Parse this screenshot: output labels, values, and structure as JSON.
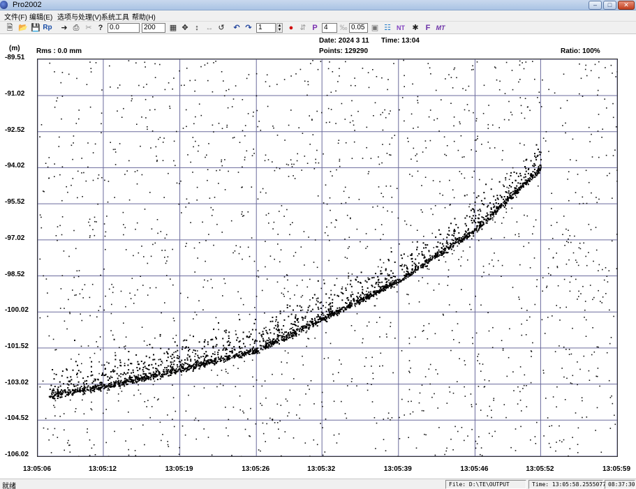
{
  "window": {
    "title": "Pro2002"
  },
  "menu": [
    "文件(F)",
    "编辑(E)",
    "选项与处理(V)",
    "系统工具",
    "帮助(H)"
  ],
  "toolbar": {
    "field_a": "0.0",
    "field_b": "200",
    "field_c": "1",
    "field_d": "4",
    "field_e": "0.05",
    "labels": {
      "rp": "Rp",
      "po": "P",
      "ft": "F",
      "mt": "MT",
      "nt": "NT"
    }
  },
  "header": {
    "unit": "(m)",
    "rms": "Rms :   0.0 mm",
    "date": "Date: 2024  3 11",
    "time": "Time: 13:04",
    "points": "Points: 129290",
    "ratio": "Ratio: 100%"
  },
  "chart_data": {
    "type": "scatter",
    "title": "",
    "xlabel": "",
    "ylabel": "(m)",
    "xlim": [
      "13:05:06",
      "13:05:59"
    ],
    "ylim": [
      -106.02,
      -89.51
    ],
    "x_ticks": [
      "13:05:06",
      "13:05:12",
      "13:05:19",
      "13:05:26",
      "13:05:32",
      "13:05:39",
      "13:05:46",
      "13:05:52",
      "13:05:59"
    ],
    "y_ticks": [
      "-89.51",
      "-91.02",
      "-92.52",
      "-94.02",
      "-95.52",
      "-97.02",
      "-98.52",
      "-100.02",
      "-101.52",
      "-103.02",
      "-104.52",
      "-106.02"
    ],
    "grid": true,
    "series": [
      {
        "x": [
          "13:05:07",
          "13:05:12",
          "13:05:19",
          "13:05:26",
          "13:05:32",
          "13:05:39",
          "13:05:46",
          "13:05:52"
        ],
        "y": [
          -103.5,
          -103.1,
          -102.4,
          -101.6,
          -100.3,
          -98.7,
          -96.6,
          -94.0
        ]
      }
    ]
  },
  "status": {
    "text": "就绪",
    "file": "File: D:\\TE\\OUTPUT",
    "time": "Time: 13:05:58.2555077",
    "clock": "08:37:30"
  }
}
